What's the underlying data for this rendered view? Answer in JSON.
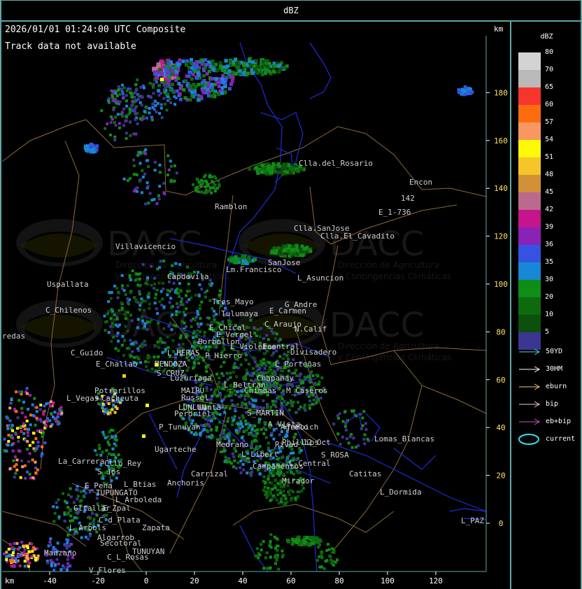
{
  "title": "dBZ",
  "header": {
    "timestamp": "2026/01/01 01:24:00 UTC Composite",
    "track_note": "Track data not available",
    "km_unit": "km"
  },
  "axes": {
    "x_unit": "km",
    "x_ticks": [
      "-40",
      "-20",
      "0",
      "20",
      "40",
      "60",
      "80",
      "100",
      "120"
    ],
    "y_ticks": [
      "180",
      "160",
      "140",
      "120",
      "100",
      "80",
      "60",
      "40",
      "20",
      "0"
    ]
  },
  "legend": {
    "title": "dBZ",
    "levels": [
      {
        "label": "80",
        "color": "#d3d3d3"
      },
      {
        "label": "70",
        "color": "#b9b9b9"
      },
      {
        "label": "65",
        "color": "#f8352c"
      },
      {
        "label": "60",
        "color": "#fb6c0f"
      },
      {
        "label": "57",
        "color": "#f89860"
      },
      {
        "label": "54",
        "color": "#fefa07"
      },
      {
        "label": "51",
        "color": "#f5c52a"
      },
      {
        "label": "48",
        "color": "#d39137"
      },
      {
        "label": "45",
        "color": "#bb6a8d"
      },
      {
        "label": "42",
        "color": "#c5158c"
      },
      {
        "label": "39",
        "color": "#8922b5"
      },
      {
        "label": "36",
        "color": "#3553e0"
      },
      {
        "label": "35",
        "color": "#1887d6"
      },
      {
        "label": "30",
        "color": "#108d17"
      },
      {
        "label": "20",
        "color": "#0d6b0e"
      },
      {
        "label": "10",
        "color": "#0c500c"
      },
      {
        "label": "5",
        "color": "#3b3691"
      }
    ],
    "tracks": [
      {
        "label": "50YD",
        "color": "#4ad8e0"
      },
      {
        "label": "30HM",
        "color": "#ffffff"
      },
      {
        "label": "eburn",
        "color": "#f2c98d"
      },
      {
        "label": "bip",
        "color": "#f7c9cf"
      },
      {
        "label": "eb+bip",
        "color": "#d54ec9"
      },
      {
        "label": "current",
        "color": "#33e3f2"
      }
    ]
  },
  "watermark": {
    "brand": "DACC",
    "line1": "Dirección de Agricultura",
    "line2": "y Contingencias Climáticas"
  },
  "places": [
    "Clla.del_Rosario",
    "Encon",
    "142",
    "E_1-736",
    "Ramblon",
    "Clla.SanJose",
    "Clla.El_Cavadito",
    "Villavicencio",
    "Capdevila",
    "Lm.Francisco",
    "SanJose",
    "L_Asuncion",
    "Uspallata",
    "Tres_Mayo",
    "G_Andre",
    "C_Chilenos",
    "Tulumaya",
    "E_Carmen",
    "C_Araujo",
    "N.Calif",
    "E_Chical",
    "E_Vergel",
    "redas",
    "Borbollon",
    "L_Violetas",
    "Ecentral",
    "Divisadero",
    "C_Guido",
    "L_HERAS",
    "P_Hierro",
    "L_Porteñas",
    "MENDOZA",
    "E_Challao",
    "S_CRUZ",
    "Luzuriaga",
    "Chapanay",
    "L_Beltran",
    "Potrerillos",
    "MAIPU",
    "Russel",
    "Chimbas",
    "M_Caseros",
    "L_Vegas",
    "Cacheuta",
    "LUNLUN",
    "Lunta",
    "Perdriel",
    "S_MARTIN",
    "A_Vista",
    "Agrelo",
    "P_Tunuyan",
    "Tambich",
    "Lomas_Blancas",
    "Ugarteche",
    "Medrano",
    "Rivad",
    "12_Oct",
    "Phillips",
    "L_Libert",
    "S_ROSA",
    "La_Carrera",
    "Ctlo_Rey",
    "S_Jos",
    "Campamentos",
    "L_Central",
    "Carrizal",
    "Catitas",
    "E_Pena",
    "L_Btias",
    "Anchoris",
    "TUPUNGATO",
    "Mirador",
    "L_Dormida",
    "L_Arboleda",
    "Gltallar",
    "E_Zpal",
    "L_PAZ",
    "C_d_Plata",
    "L_Arbols",
    "Zapata",
    "Algarrob",
    "Secotoral",
    "TUNUYAN",
    "Manzano",
    "C_L_Rosas",
    "V_Flores"
  ]
}
